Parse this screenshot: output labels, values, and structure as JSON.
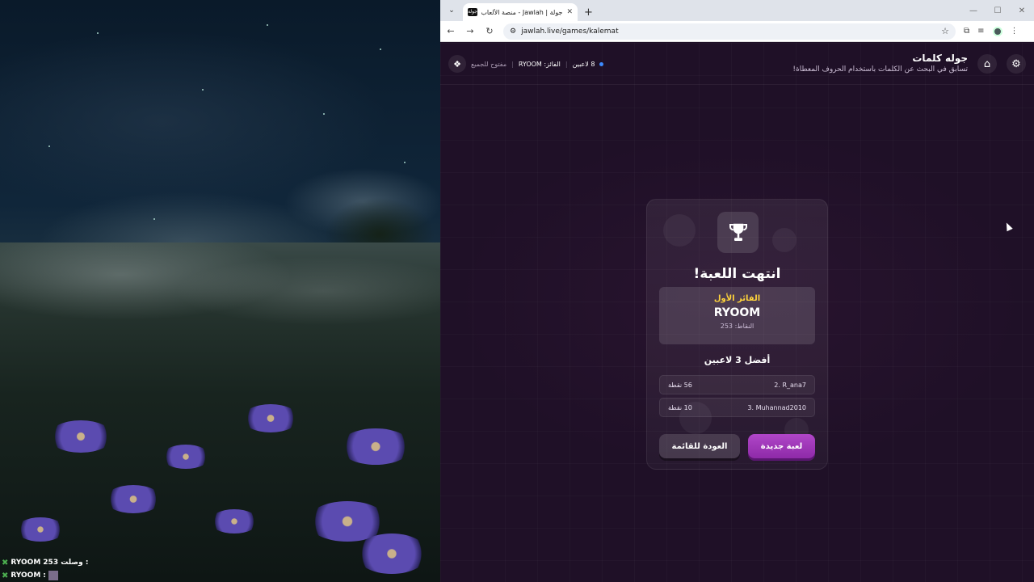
{
  "stream_overlay": {
    "chat": [
      {
        "user": "RYOOM",
        "text": "وصلت 253 :"
      },
      {
        "user": "RYOOM",
        "text": ":"
      }
    ]
  },
  "browser": {
    "tab_title": "جولة | Jawlah - منصة الألعاب الت...",
    "tab_favicon_text": "جولة",
    "url": "jawlah.live/games/kalemat"
  },
  "app": {
    "title": "جوله كلمات",
    "subtitle": "تسابق في البحث عن الكلمات باستخدام الحروف المعطاة!",
    "status": {
      "players": "8 لاعبين",
      "winner": "الفائز: RYOOM",
      "access": "مفتوح للجميع"
    }
  },
  "result": {
    "title": "انتهت اللعبة!",
    "winner_label": "الفائز الأول",
    "winner_name": "RYOOM",
    "winner_points": "النقاط: 253",
    "top_title": "أفضل 3 لاعبين",
    "others": [
      {
        "rank_name": "2. R_ana7",
        "points": "56 نقطة"
      },
      {
        "rank_name": "3. Muhannad2010",
        "points": "10 نقطة"
      }
    ],
    "new_game_label": "لعبة جديدة",
    "back_label": "العودة للقائمة"
  },
  "colors": {
    "accent": "#b046c8",
    "gold": "#ffd43b",
    "background": "#1f1027",
    "online_dot": "#3d8bff"
  },
  "icons": [
    "settings-icon",
    "home-icon",
    "trophy-icon",
    "logo-icon",
    "reload-icon",
    "star-icon"
  ]
}
